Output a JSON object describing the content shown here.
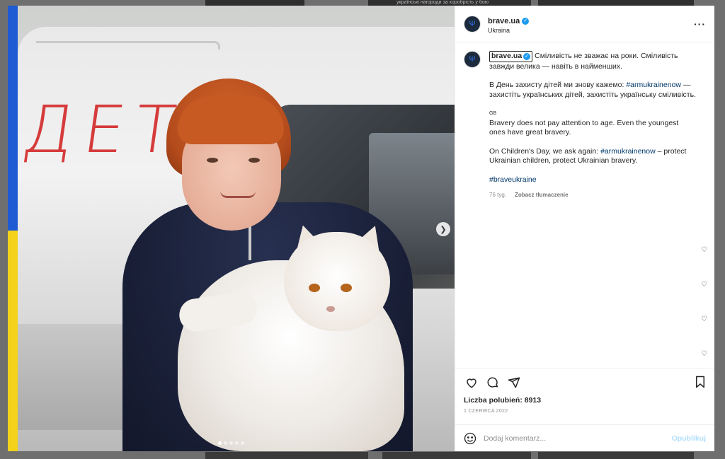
{
  "backdrop": {
    "top_text": "українські нагороди за хоробрість у бою"
  },
  "post": {
    "image_word": "ДЕТИ",
    "carousel": {
      "count": 5,
      "active": 0
    }
  },
  "header": {
    "username": "brave.ua",
    "location": "Ukraina",
    "more_icon": "more-horizontal-icon"
  },
  "caption": {
    "username": "brave.ua",
    "line1": "Сміливість не зважає на роки. Сміливість завжди велика — навіть в найменших.",
    "line2_pre": "В День захисту дітей ми знову кажемо: ",
    "line2_tag": "#armukrainenow",
    "line2_post": " — захистіть українських дітей, захистіть українську сміливість.",
    "gb_label": "GB",
    "en1": "Bravery does not pay attention to age. Even the youngest ones have great bravery.",
    "en2_pre": "On Children's Day, we ask again: ",
    "en2_tag": "#armukrainenow",
    "en2_post": " – protect Ukrainian children, protect Ukrainian bravery.",
    "hashtag": "#braveukraine",
    "time": "76 tyg.",
    "translate": "Zobacz tłumaczenie"
  },
  "actions": {
    "likes": "Liczba polubień: 8913",
    "date": "1 CZERWCA 2022"
  },
  "comment_box": {
    "placeholder": "Dodaj komentarz...",
    "post_label": "Opublikuj"
  },
  "colors": {
    "flag_blue": "#1f5bd2",
    "flag_yellow": "#f2d21b",
    "link": "#00376b",
    "post_disabled": "#b2dffc"
  }
}
